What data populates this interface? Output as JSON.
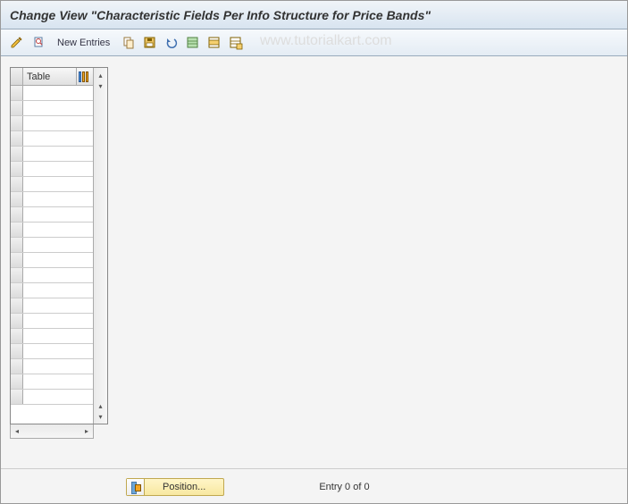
{
  "header": {
    "title": "Change View \"Characteristic Fields Per Info Structure for Price Bands\""
  },
  "toolbar": {
    "new_entries_label": "New Entries",
    "icons": {
      "change": "change-icon",
      "other_view": "other-view-icon",
      "copy": "copy-icon",
      "save_var": "save-variant-icon",
      "undo": "undo-icon",
      "select_all": "select-all-icon",
      "select_block": "select-block-icon",
      "deselect": "deselect-icon"
    }
  },
  "watermark": "www.tutorialkart.com",
  "table": {
    "column_header": "Table",
    "rows": [
      "",
      "",
      "",
      "",
      "",
      "",
      "",
      "",
      "",
      "",
      "",
      "",
      "",
      "",
      "",
      "",
      "",
      "",
      "",
      "",
      ""
    ]
  },
  "footer": {
    "position_label": "Position...",
    "entry_status": "Entry 0 of 0"
  }
}
